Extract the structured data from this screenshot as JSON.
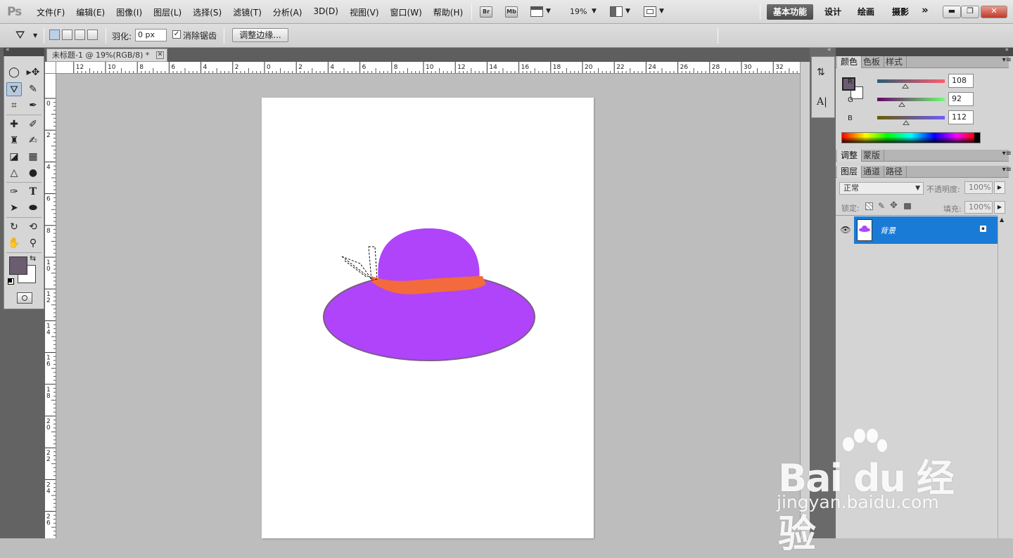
{
  "app": {
    "logo": "Ps",
    "menus": [
      "文件(F)",
      "编辑(E)",
      "图像(I)",
      "图层(L)",
      "选择(S)",
      "滤镜(T)",
      "分析(A)",
      "3D(D)",
      "视图(V)",
      "窗口(W)",
      "帮助(H)"
    ],
    "bridge_btn": "Br",
    "mini_bridge_btn": "Mb",
    "zoom": "19%",
    "workspaces": {
      "active": "基本功能",
      "others": [
        "设计",
        "绘画",
        "摄影"
      ],
      "more": "»"
    }
  },
  "options": {
    "feather_label": "羽化:",
    "feather_value": "0 px",
    "antialias_label": "消除锯齿",
    "refine_edge": "调整边缘..."
  },
  "document": {
    "tab_title": "未标题-1 @ 19%(RGB/8) *",
    "ruler_top": [
      "12",
      "10",
      "8",
      "6",
      "4",
      "2",
      "0",
      "2",
      "4",
      "6",
      "8",
      "10",
      "12",
      "14",
      "16",
      "18",
      "20",
      "22",
      "24",
      "26",
      "28",
      "30",
      "32"
    ],
    "ruler_left": [
      "0",
      "2",
      "4",
      "6",
      "8",
      "10",
      "12",
      "14",
      "16",
      "18",
      "20",
      "22",
      "24",
      "26"
    ]
  },
  "colors": {
    "foreground": "#6c5c70",
    "hat_fill": "#af44fb",
    "band_fill": "#f36a3d",
    "selection_highlight": "#1a7bd6"
  },
  "panels": {
    "color_tabs": [
      "颜色",
      "色板",
      "样式"
    ],
    "channels": [
      {
        "label": "R",
        "value": "108"
      },
      {
        "label": "G",
        "value": "92"
      },
      {
        "label": "B",
        "value": "112"
      }
    ],
    "adjust_tabs": [
      "调整",
      "蒙版"
    ],
    "layer_tabs": [
      "图层",
      "通道",
      "路径"
    ],
    "blend_mode": "正常",
    "opacity_label": "不透明度:",
    "opacity_value": "100%",
    "lock_label": "锁定:",
    "fill_label": "填充:",
    "fill_value": "100%",
    "layer_name": "背景"
  },
  "watermark": {
    "logo": "Bai du 经验",
    "url": "jingyan.baidu.com"
  }
}
